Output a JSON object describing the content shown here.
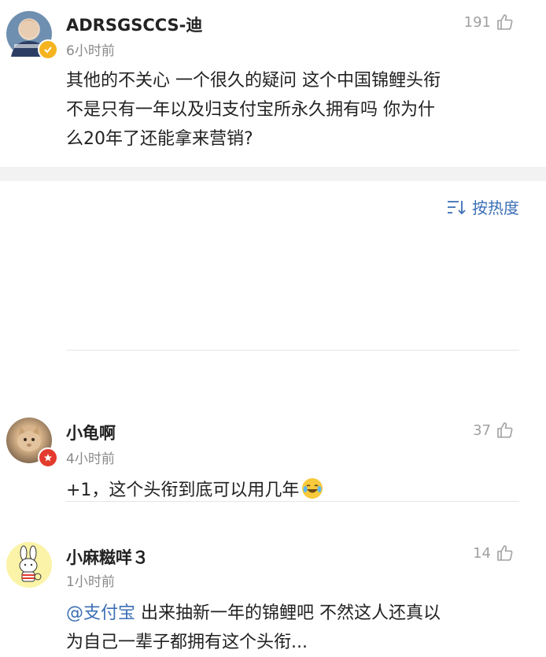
{
  "main_comment": {
    "username": "ADRSGSCCS-迪",
    "time": "6小时前",
    "likes": "191",
    "text_lines": [
      "其他的不关心 一个很久的疑问  这个中国锦鲤头衔",
      "不是只有一年以及归支付宝所永久拥有吗  你为什",
      "么20年了还能拿来营销?"
    ]
  },
  "sort": {
    "label": "按热度",
    "icon": "sort-icon"
  },
  "replies": [
    {
      "username": "小龟啊",
      "time": "4小时前",
      "likes": "37",
      "text": "+1，这个头衔到底可以用几年",
      "emoji": "laughing-tears-emoji"
    },
    {
      "username": "小麻糍咩３",
      "time": "1小时前",
      "likes": "14",
      "mention": "@支付宝",
      "text_line1": " 出来抽新一年的锦鲤吧 不然这人还真以",
      "text_line2": "为自己一辈子都拥有这个头衔..."
    }
  ],
  "colors": {
    "link": "#3c6fb6",
    "verified_badge": "#f5b41f",
    "red_badge": "#e23b2e"
  }
}
